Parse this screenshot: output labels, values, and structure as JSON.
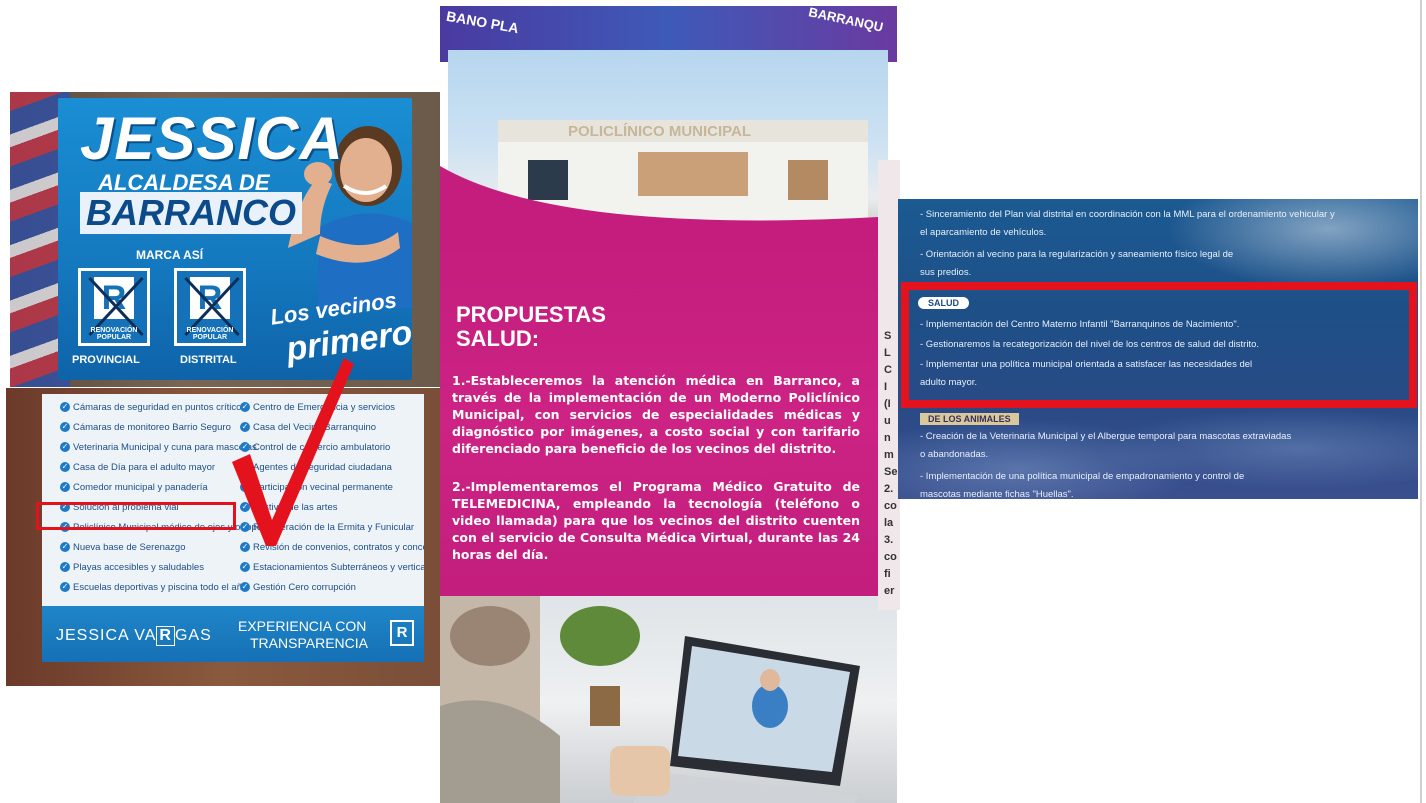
{
  "poster": {
    "name": "JESSICA",
    "role_line1": "ALCALDESA DE",
    "role_line2": "BARRANCO",
    "mark_label": "MARCA ASÍ",
    "ballot_letter": "R",
    "party": "RENOVACIÓN POPULAR",
    "ballot_left_label": "PROVINCIAL",
    "ballot_right_label": "DISTRITAL",
    "slogan_line1": "Los vecinos",
    "slogan_line2": "primero"
  },
  "flyer": {
    "left_items": [
      "Cámaras de seguridad en puntos críticos",
      "Cámaras de monitoreo Barrio Seguro",
      "Veterinaria Municipal y cuna para mascotas",
      "Casa de Día para el adulto mayor",
      "Comedor municipal y panadería",
      "Solución al problema vial",
      "Policlínico Municipal médico de ojos y ortopedia",
      "Nueva base de Serenazgo",
      "Playas accesibles y saludables",
      "Escuelas deportivas y piscina todo el año"
    ],
    "right_items": [
      "Centro de Emergencia y servicios",
      "Casa del Vecino Barranquino",
      "Control de comercio ambulatorio",
      "Agentes de seguridad ciudadana",
      "Participación vecinal permanente",
      "Festival de las artes",
      "Recuperación de la Ermita y Funicular",
      "Revisión de convenios, contratos y concesiones",
      "Estacionamientos Subterráneos y verticales",
      "Gestión Cero corrupción"
    ],
    "footer_name_pre": "JESSICA VA",
    "footer_name_r": "R",
    "footer_name_post": "GAS",
    "footer_tag1": "EXPERIENCIA CON",
    "footer_tag2": "TRANSPARENCIA",
    "footer_r": "R"
  },
  "middle": {
    "strip_left": "BANO PLA",
    "strip_right": "BARRANQU",
    "building_sign": "POLICLÍNICO MUNICIPAL",
    "heading_1": "PROPUESTAS",
    "heading_2": "SALUD:",
    "para_1": "1.-Estableceremos la atención médica en Barranco, a través de la implementación de un Moderno Policlínico Municipal, con servicios de especialidades médicas y diagnóstico por imágenes, a costo social y con tarifario diferenciado para beneficio de los vecinos del distrito.",
    "para_2": "2.-Implementaremos el Programa Médico Gratuito de TELEMEDICINA, empleando la tecnología (teléfono o video llamada) para que los vecinos del distrito cuenten con el servicio de Consulta Médica Virtual, durante las 24 horas del día."
  },
  "right": {
    "edge_letters": [
      "S",
      "L",
      "C",
      "I",
      "(I",
      "u",
      "n",
      "m",
      "Se",
      "2.",
      "co",
      "la",
      "3.",
      "co",
      "fi",
      "er"
    ],
    "line_1": "- Sinceramiento del Plan vial distrital en coordinación con la MML para el ordenamiento vehicular y",
    "line_2": "  el aparcamiento de vehículos.",
    "line_3": "- Orientación al vecino para la regularización y saneamiento físico legal de",
    "line_4": "  sus predios.",
    "salud_label": "SALUD",
    "salud_1": "- Implementación del Centro Materno Infantil \"Barranquinos de Nacimiento\".",
    "salud_2": "- Gestionaremos la recategorización del nivel de los centros de salud del distrito.",
    "salud_3": "- Implementar una política municipal orientada a satisfacer las necesidades del",
    "salud_4": "  adulto mayor.",
    "section_2_label": "DE LOS ANIMALES",
    "animal_1": "- Creación de la Veterinaria Municipal y el Albergue temporal para mascotas extraviadas",
    "animal_2": "  o abandonadas.",
    "animal_3": "- Implementación de una política municipal de empadronamiento y control de",
    "animal_4": "  mascotas mediante fichas \"Huellas\"."
  },
  "colors": {
    "highlight_red": "#e4121c",
    "campaign_blue": "#1478be",
    "campaign_pink": "#c41d7e"
  }
}
